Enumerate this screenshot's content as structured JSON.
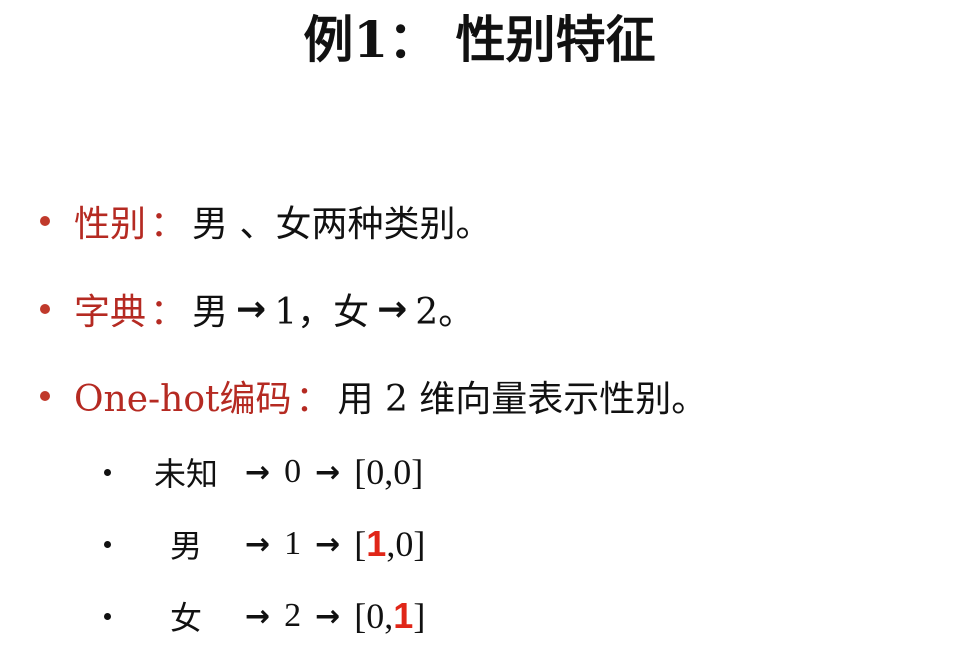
{
  "title": "例1：  性别特征",
  "colors": {
    "accent": "#b52a22",
    "highlight": "#e02618",
    "text": "#111111"
  },
  "bullets": [
    {
      "term": "性别",
      "colon": "：",
      "desc": "男 、女两种类别。"
    },
    {
      "term": "字典",
      "colon": "：",
      "parts": [
        "男",
        "1，女",
        "2。"
      ]
    },
    {
      "term": "One-hot编码",
      "colon": "：",
      "desc": "用 2 维向量表示性别。"
    }
  ],
  "arrow_icon": "→",
  "sub_items": [
    {
      "label": "未知",
      "index": "0",
      "vec_open": "[",
      "v1": "0",
      "comma": ",",
      "v2": "0",
      "vec_close": "]",
      "highlight": "none"
    },
    {
      "label": "男",
      "index": "1",
      "vec_open": "[",
      "v1": "1",
      "comma": ",",
      "v2": "0",
      "vec_close": "]",
      "highlight": "v1"
    },
    {
      "label": "女",
      "index": "2",
      "vec_open": "[",
      "v1": "0",
      "comma": ",",
      "v2": "1",
      "vec_close": "]",
      "highlight": "v2"
    }
  ]
}
